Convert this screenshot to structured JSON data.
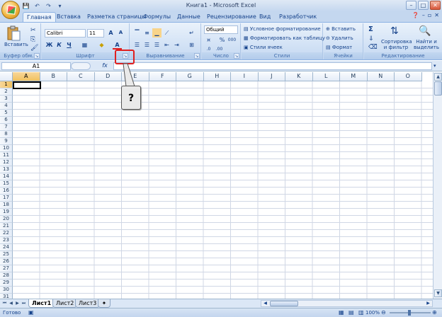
{
  "window": {
    "title": "Книга1 - Microsoft Excel"
  },
  "qat": {
    "save": "💾",
    "undo": "↶",
    "redo": "↷",
    "more": "▾"
  },
  "tabs": [
    "Главная",
    "Вставка",
    "Разметка страницы",
    "Формулы",
    "Данные",
    "Рецензирование",
    "Вид",
    "Разработчик"
  ],
  "ribbon": {
    "clipboard": {
      "paste": "Вставить",
      "label": "Буфер обм..."
    },
    "font": {
      "name": "Calibri",
      "size": "11",
      "bold": "Ж",
      "italic": "К",
      "underline": "Ч",
      "grow": "A",
      "shrink": "A",
      "color": "A",
      "label": "Шрифт"
    },
    "alignment": {
      "label": "Выравнивание"
    },
    "number": {
      "format": "Общий",
      "percent": "%",
      "thousands": "000",
      "label": "Число"
    },
    "styles": {
      "conditional": "Условное форматирование",
      "table": "Форматировать как таблицу",
      "cell_styles": "Стили ячеек",
      "label": "Стили"
    },
    "cells": {
      "insert": "Вставить",
      "delete": "Удалить",
      "format": "Формат",
      "label": "Ячейки"
    },
    "editing": {
      "sigma": "Σ",
      "sort": "Сортировка",
      "sort2": "и фильтр",
      "find": "Найти и",
      "find2": "выделить",
      "label": "Редактирование"
    }
  },
  "formula_bar": {
    "name_box": "A1",
    "fx": "fx"
  },
  "columns": [
    "A",
    "B",
    "C",
    "D",
    "E",
    "F",
    "G",
    "H",
    "I",
    "J",
    "K",
    "L",
    "M",
    "N",
    "O"
  ],
  "rows": [
    "1",
    "2",
    "3",
    "4",
    "5",
    "6",
    "7",
    "8",
    "9",
    "10",
    "11",
    "12",
    "13",
    "14",
    "15",
    "16",
    "17",
    "18",
    "19",
    "20",
    "21",
    "22",
    "23",
    "24",
    "25",
    "26",
    "27",
    "28",
    "29",
    "30",
    "31"
  ],
  "sheets": [
    "Лист1",
    "Лист2",
    "Лист3"
  ],
  "status": {
    "ready": "Готово",
    "zoom": "100%"
  },
  "callout": {
    "text": "?"
  },
  "colors": {
    "accent": "#15428b",
    "highlight": "#e02020",
    "selected_header": "#f1c15f"
  }
}
